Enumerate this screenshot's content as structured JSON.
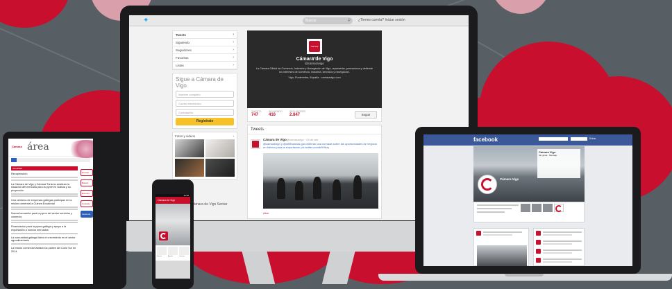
{
  "colors": {
    "brand_red": "#c8102e",
    "twitter_blue": "#1da1f2",
    "facebook_blue": "#3b5998",
    "background": "#575e64"
  },
  "monitor": {
    "search_placeholder": "Buscar",
    "signup_text": "¿Tienes cuenta? Iniciar sesión",
    "nav": [
      {
        "label": "Tweets",
        "bold": true
      },
      {
        "label": "Siguiendo"
      },
      {
        "label": "Seguidores"
      },
      {
        "label": "Favoritos"
      },
      {
        "label": "Listas"
      }
    ],
    "follow_box": {
      "title": "Sigue a Cámara de Vigo",
      "fields": [
        "Nombre completo",
        "Correo electrónico",
        "Contraseña"
      ],
      "button": "Regístrate"
    },
    "media_title": "Fotos y videos",
    "profile": {
      "logo_text": "Cámara Vigo",
      "name": "Cámara de Vigo",
      "handle": "@camaravigo",
      "bio": "La Cámara Oficial de Comercio, Industria y Navegación de Vigo, representa, promociona y defiende los intereses del comercio, industria, servicios y navegación.",
      "location": "Vigo, Pontevedra, España · camaravigo.com",
      "stats": [
        {
          "label": "TWEETS",
          "value": "747"
        },
        {
          "label": "SIGUIENDO",
          "value": "416"
        },
        {
          "label": "SEGUIDORES",
          "value": "2.847"
        }
      ],
      "follow_button": "Seguir"
    },
    "tweets_title": "Tweets",
    "tweet": {
      "author": "Cámara de Vigo",
      "meta": "@camaravigo · 29 de abr.",
      "text": "@camaravigo y @delfinanzas.gal celebran una xornada sobre las oportunidades de negocio en México para la exportación pic.twitter.com/bRHbzy"
    },
    "tweet_actions": "Abrir",
    "promo_text": "Sé parte de Cámara de Vigo  Sentar"
  },
  "tablet": {
    "brand": "Cámara",
    "title": "área",
    "section": "Actualidad",
    "headlines": [
      "Recuperación",
      "La Cámara de Vigo y Cámara Turismo analizan la situación del mercado para la pyme en Galicia y su proyección",
      "Una veintena de empresas gallegas participan en la misión comercial a Guinea Ecuatorial",
      "Nueva formación para la pyme del sector servicios y comercio",
      "Financiación para la pyme gallega y apoyo a la exportación a nuevos mercados",
      "La comunidad gallega lidera el crecimiento en el sector agroalimentario",
      "La misión comercial visitará los países del Cono Sur en 2014"
    ],
    "side_buttons": [
      "Dossier",
      "Boletín",
      "Eventos",
      "Contacto",
      "facebook"
    ]
  },
  "phone": {
    "time": "12:30",
    "title": "Cámara de Vigo",
    "tabs": [
      "Noticias",
      "Agenda",
      "Contacto"
    ]
  },
  "laptop": {
    "logo": "facebook",
    "login_button": "Entrar",
    "cover_card_title": "Cámara Vigo",
    "cover_card_text": "Me gusta · Mensaje",
    "page_name": "Cámara Vigo"
  }
}
